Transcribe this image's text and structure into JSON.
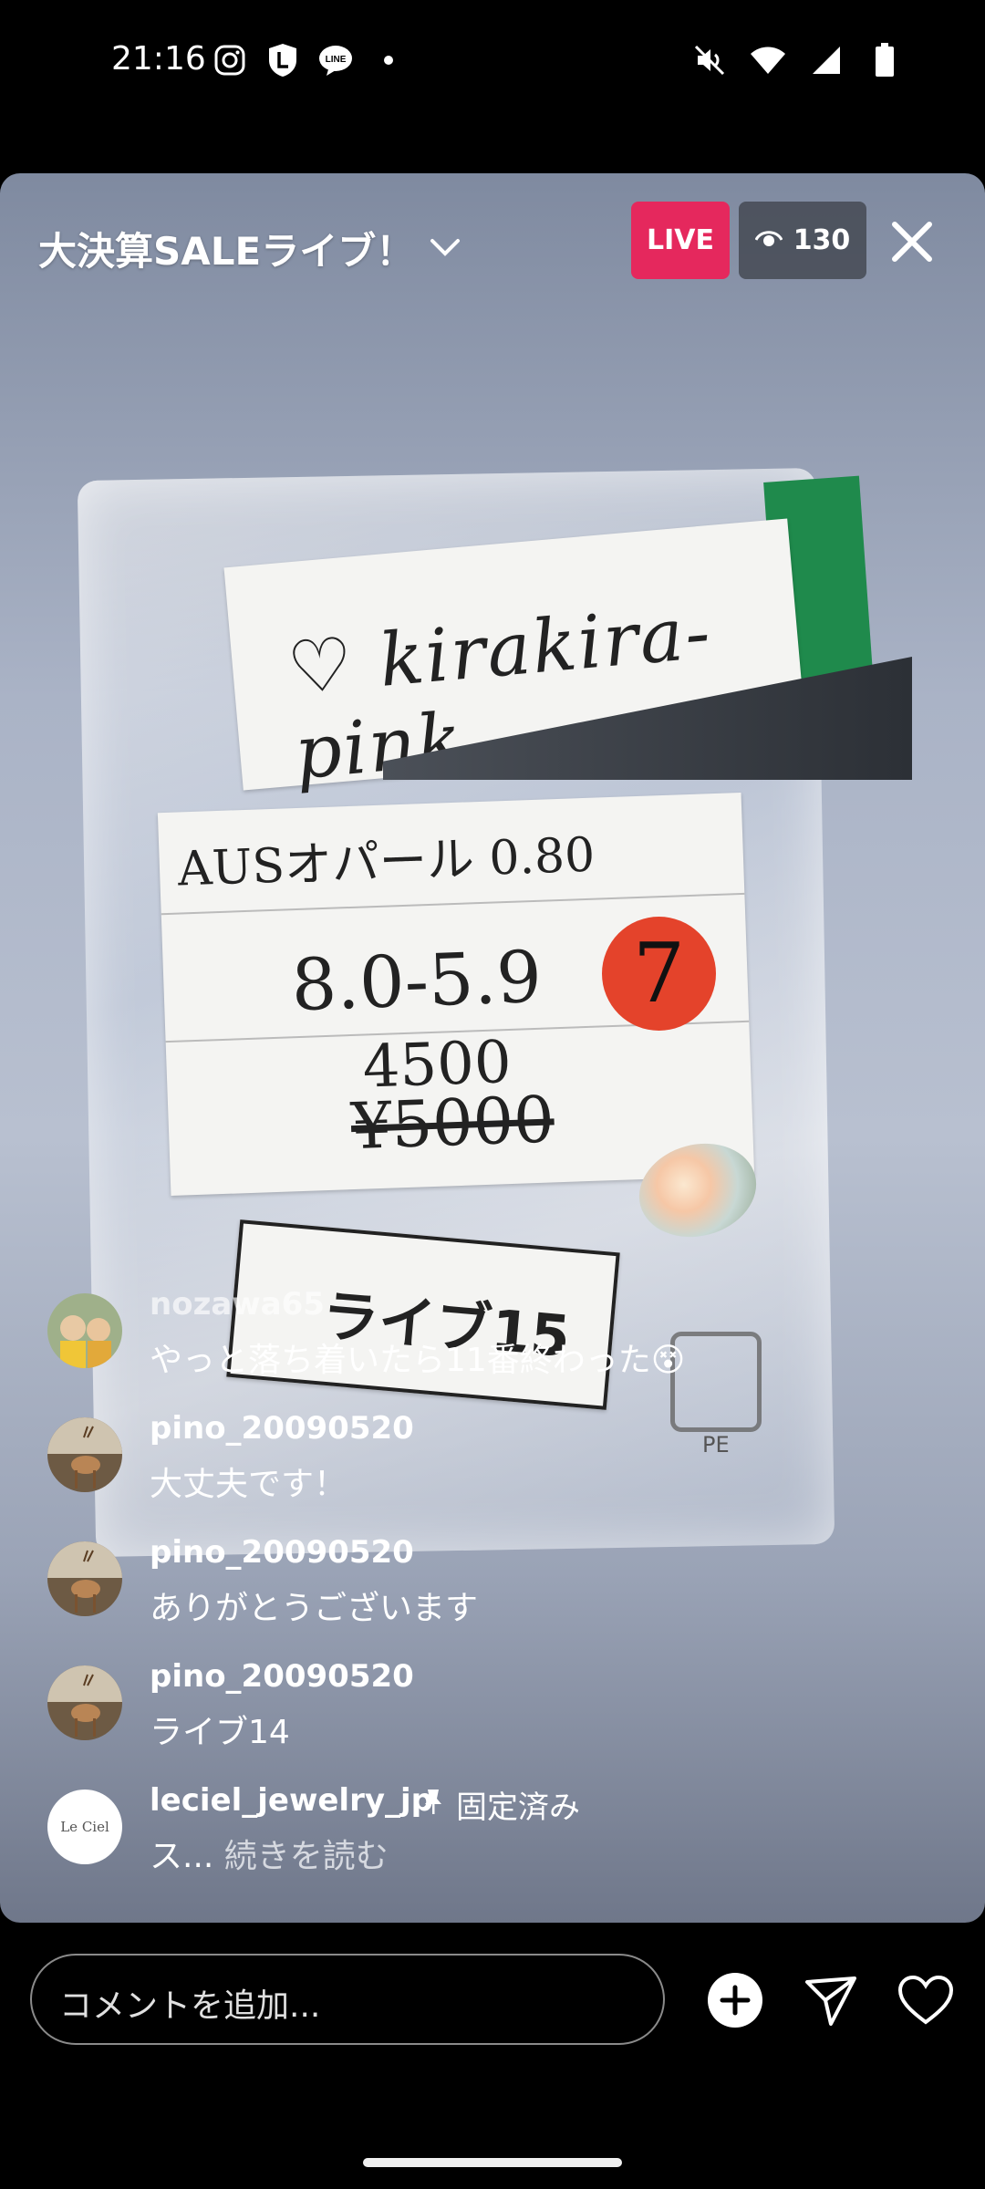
{
  "status_bar": {
    "time": "21:16",
    "left_icons": [
      "instagram-icon",
      "shield-l-icon",
      "line-icon",
      "dot-icon"
    ],
    "right_icons": [
      "mute-icon",
      "wifi-icon",
      "signal-icon",
      "battery-icon"
    ]
  },
  "live": {
    "title": "大決算SALEライブ！",
    "badge": "LIVE",
    "viewer_count": "130",
    "video_text": {
      "card_tag": "kirakira-pink",
      "card_line1": "AUSオパール 0.80",
      "card_line2": "8.0-5.9",
      "circle_number": "7",
      "new_price": "4500",
      "old_price": "¥5000",
      "label_card": "ライブ15",
      "pe_mark": "PE"
    }
  },
  "comments": [
    {
      "user": "nozawa65",
      "text": "やっと落ち着いたら11番終わった😵"
    },
    {
      "user": "pino_20090520",
      "text": "大丈夫です！"
    },
    {
      "user": "pino_20090520",
      "text": "ありがとうございます"
    },
    {
      "user": "pino_20090520",
      "text": "ライブ14"
    }
  ],
  "pinned_comment": {
    "user": "leciel_jewelry_jp",
    "pinned_label": "固定済み",
    "text_start": "ス...",
    "read_more": "続きを読む",
    "avatar_text": "Le Ciel"
  },
  "bottom_bar": {
    "placeholder": "コメントを追加...",
    "icons": [
      "add-circle-icon",
      "send-icon",
      "heart-icon"
    ]
  },
  "colors": {
    "live_badge": "#e5285d",
    "background": "#000000"
  }
}
